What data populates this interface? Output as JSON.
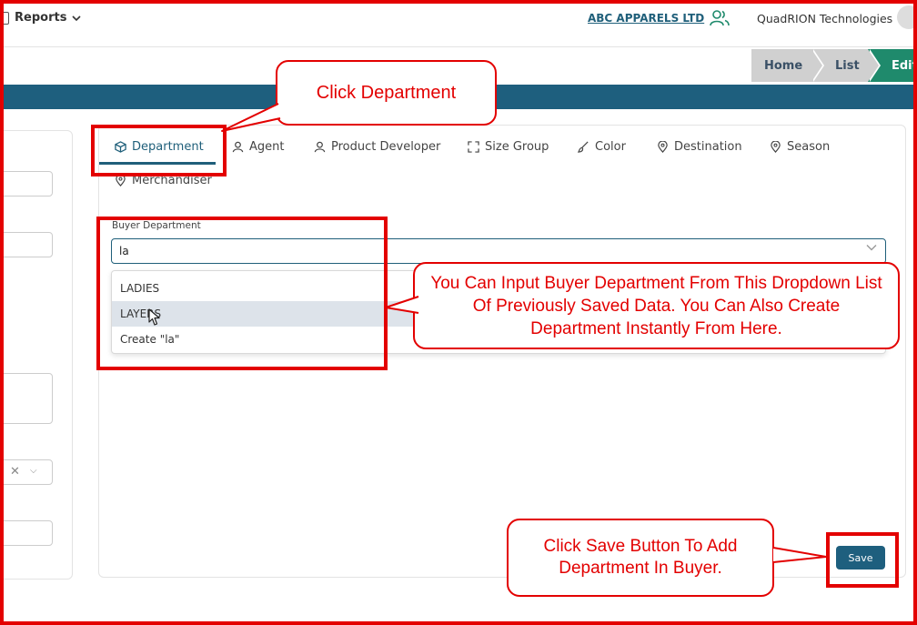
{
  "header": {
    "reports_label": "Reports",
    "company": "ABC APPARELS LTD",
    "organization": "QuadRION Technologies"
  },
  "breadcrumb": [
    "Home",
    "List",
    "Edit"
  ],
  "tabs": [
    {
      "label": "Department",
      "icon": "cube-icon"
    },
    {
      "label": "Agent",
      "icon": "user-icon"
    },
    {
      "label": "Product Developer",
      "icon": "user-icon"
    },
    {
      "label": "Size Group",
      "icon": "expand-icon"
    },
    {
      "label": "Color",
      "icon": "brush-icon"
    },
    {
      "label": "Destination",
      "icon": "pin-icon"
    },
    {
      "label": "Season",
      "icon": "pin-icon"
    },
    {
      "label": "Merchandiser",
      "icon": "pin-icon"
    }
  ],
  "form": {
    "buyer_department_label": "Buyer Department",
    "buyer_department_value": "la",
    "options": [
      "LADIES",
      "LAYERS",
      "Create \"la\""
    ]
  },
  "save_label": "Save",
  "annotations": {
    "click_department": "Click Department",
    "dropdown_note": "You Can Input Buyer Department From This Dropdown List Of Previously Saved Data. You Can Also Create Department Instantly From Here.",
    "save_note": "Click Save Button To Add Department In Buyer."
  },
  "colors": {
    "primary": "#1e5f7e",
    "accent_green": "#1f8a6c",
    "annotation_red": "#e30000"
  }
}
